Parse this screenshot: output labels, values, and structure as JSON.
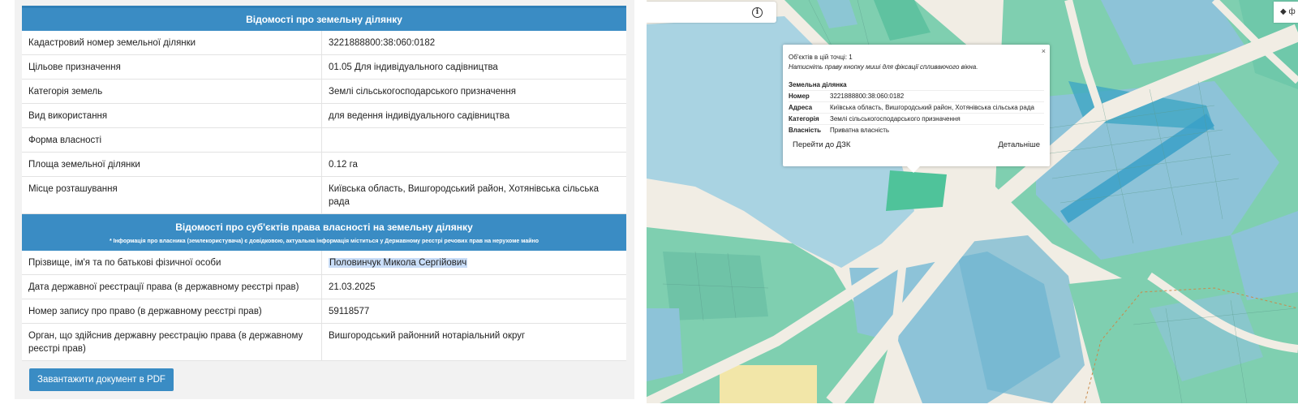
{
  "parcel_info": {
    "header": "Відомості про земельну ділянку",
    "rows": [
      {
        "label": "Кадастровий номер земельної ділянки",
        "value": "3221888800:38:060:0182"
      },
      {
        "label": "Цільове призначення",
        "value": "01.05 Для індивідуального садівництва"
      },
      {
        "label": "Категорія земель",
        "value": "Землі сільськогосподарського призначення"
      },
      {
        "label": "Вид використання",
        "value": "для ведення індивідуального садівництва"
      },
      {
        "label": "Форма власності",
        "value": ""
      },
      {
        "label": "Площа земельної ділянки",
        "value": "0.12 га"
      },
      {
        "label": "Місце розташування",
        "value": "Київська область, Вишгородський район, Хотянівська сільська рада"
      }
    ]
  },
  "ownership_info": {
    "header": "Відомості про суб'єктів права власності на земельну ділянку",
    "note": "* Інформація про власника (землекористувача) є довідковою, актуальна інформація міститься у Державному реєстрі речових прав на нерухоме майно",
    "rows": [
      {
        "label": "Прізвище, ім'я та по батькові фізичної особи",
        "value": "Половинчук Микола Сергійович"
      },
      {
        "label": "Дата державної реєстрації права (в державному реєстрі прав)",
        "value": "21.03.2025"
      },
      {
        "label": "Номер запису про право (в державному реєстрі прав)",
        "value": "59118577"
      },
      {
        "label": "Орган, що здійснив державну реєстрацію права (в державному реєстрі прав)",
        "value": "Вишгородський районний нотаріальний округ"
      }
    ]
  },
  "download_button": "Завантажити документ в PDF",
  "map": {
    "info_icon_glyph": "i",
    "layer_button_label": "◆ ф",
    "popup": {
      "close": "×",
      "objects_count": "Об'єктів в цій точці: 1",
      "hint": "Натисніть праву кнопку миші для фіксації спливаючого вікна.",
      "title": "Земельна ділянка",
      "rows": [
        {
          "label": "Номер",
          "value": "3221888800:38:060:0182"
        },
        {
          "label": "Адреса",
          "value": "Київська область, Вишгородський район, Хотянівська сільська рада"
        },
        {
          "label": "Категорія",
          "value": "Землі сільськогосподарського призначення"
        },
        {
          "label": "Власність",
          "value": "Приватна власність"
        }
      ],
      "link_dzk": "Перейти до ДЗК",
      "link_details": "Детальніше"
    }
  },
  "colors": {
    "accent": "#3a8cc4",
    "selection": "#c9ddf7",
    "parcel_green": "#7fcfb0",
    "parcel_blue": "#8dc3d8",
    "water": "#a9d3e2",
    "road": "#f1ede4"
  }
}
